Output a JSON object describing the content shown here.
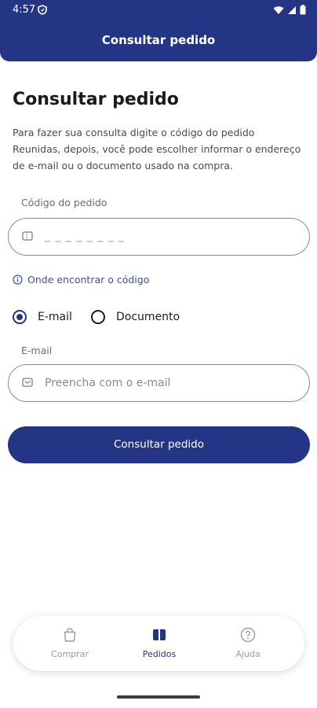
{
  "status_bar": {
    "time": "4:57"
  },
  "header": {
    "title": "Consultar pedido"
  },
  "main": {
    "title": "Consultar pedido",
    "description": "Para fazer sua consulta digite o código do pedido Reunidas, depois, você pode escolher informar o endereço de e-mail ou o documento usado na compra.",
    "order_code": {
      "label": "Código do pedido",
      "value": "_ _ _ _ _ _ _ _"
    },
    "help_link": "Onde encontrar o código",
    "radio_options": {
      "email": "E-mail",
      "document": "Documento",
      "selected": "email"
    },
    "email_field": {
      "label": "E-mail",
      "placeholder": "Preencha com o e-mail"
    },
    "submit_label": "Consultar pedido"
  },
  "bottom_nav": {
    "items": [
      {
        "label": "Comprar",
        "icon": "bag-icon"
      },
      {
        "label": "Pedidos",
        "icon": "tickets-icon",
        "active": true
      },
      {
        "label": "Ajuda",
        "icon": "help-circle-icon"
      }
    ]
  },
  "colors": {
    "brand": "#253585",
    "link": "#3b4fa0"
  }
}
